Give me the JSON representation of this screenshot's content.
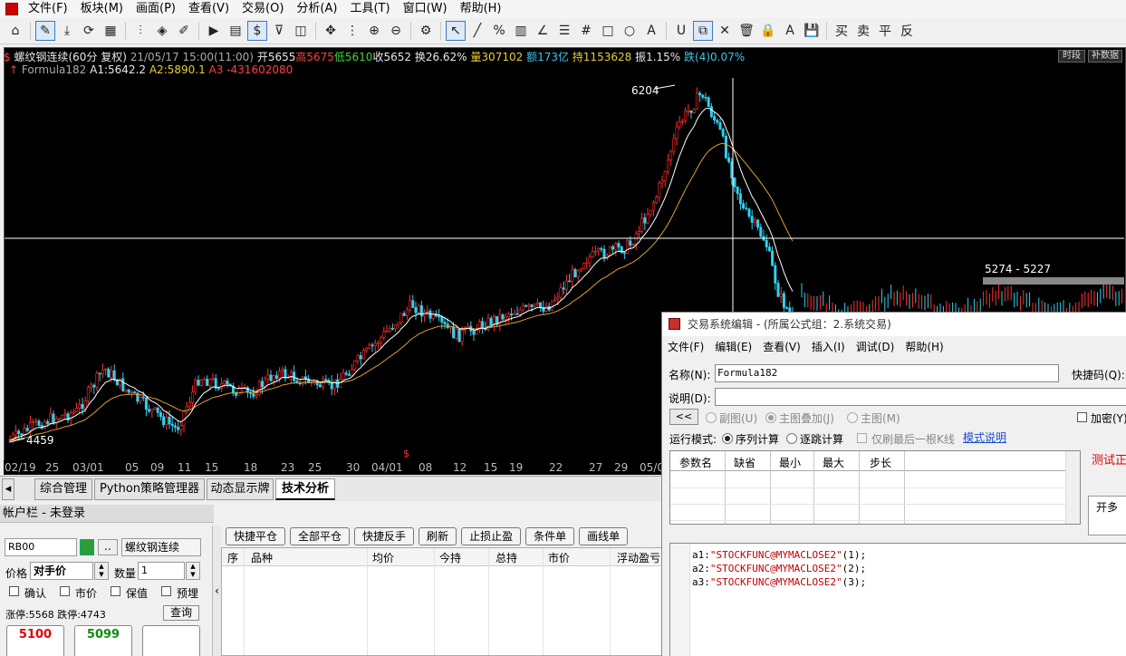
{
  "menu": [
    "文件(F)",
    "板块(M)",
    "画面(P)",
    "查看(V)",
    "交易(O)",
    "分析(A)",
    "工具(T)",
    "窗口(W)",
    "帮助(H)"
  ],
  "chart": {
    "symbol": "螺纹钢连续(60分 复权)",
    "datetime": "21/05/17 15:00(11:00)",
    "open": "开5655",
    "high": "高5675",
    "low": "低5610",
    "close": "收5652",
    "turnover": "换26.62%",
    "volume": "量307102",
    "amount": "额173亿",
    "oi": "持1153628",
    "amp": "振1.15%",
    "chg": "跌(4)0.07%",
    "formula": "Formula182",
    "a1": "A1:5642.2",
    "a2": "A2:5890.1",
    "a3": "A3 -431602080",
    "btn_time": "时段",
    "btn_supp": "补数据",
    "high_label": "6204",
    "low_label": "4459",
    "range_label": "5274 - 5227",
    "dates": [
      "02/19",
      "25",
      "03/01",
      "05",
      "09",
      "11",
      "15",
      "18",
      "23",
      "25",
      "30",
      "04/01",
      "08",
      "12",
      "15",
      "19",
      "22",
      "27",
      "29",
      "05/0"
    ]
  },
  "tabs": [
    "综合管理",
    "Python策略管理器",
    "动态显示牌",
    "技术分析"
  ],
  "account": {
    "title": "帐户栏 - 未登录"
  },
  "order": {
    "code": "RB00",
    "name": "螺纹钢连续",
    "price_label": "价格",
    "price_value": "对手价",
    "qty_label": "数量",
    "qty_value": "1",
    "confirm": "确认",
    "market": "市价",
    "keep": "保值",
    "pre": "预埋",
    "limit": "涨停:5568 跌停:4743",
    "query": "查询",
    "buy_price": "5100",
    "sell_price": "5099"
  },
  "positions": {
    "buttons": [
      "快捷平仓",
      "全部平仓",
      "快捷反手",
      "刷新",
      "止损止盈",
      "条件单",
      "画线单"
    ],
    "columns": [
      "序",
      "品种",
      "均价",
      "今持",
      "总持",
      "市价",
      "浮动盈亏"
    ]
  },
  "dialog": {
    "title": "交易系统编辑 - (所属公式组：2.系统交易)",
    "menu": [
      "文件(F)",
      "编辑(E)",
      "查看(V)",
      "插入(I)",
      "调试(D)",
      "帮助(H)"
    ],
    "name_label": "名称(N):",
    "name_value": "Formula182",
    "hotkey_label": "快捷码(Q):",
    "desc_label": "说明(D):",
    "collapse": "<<",
    "sub": "副图(U)",
    "main_overlay": "主图叠加(J)",
    "main": "主图(M)",
    "encrypt": "加密(Y)",
    "run_mode_label": "运行模式:",
    "seq": "序列计算",
    "tick": "逐跳计算",
    "last_only": "仅刷最后一根K线",
    "mode_help": "模式说明",
    "params_header": [
      "参数名",
      "缺省",
      "最小",
      "最大",
      "步长"
    ],
    "test": "测试正",
    "open_more": "开多",
    "code": [
      {
        "pre": "a1:",
        "str": "\"STOCKFUNC@MYMACLOSE2\"",
        "post": "(1);"
      },
      {
        "pre": "a2:",
        "str": "\"STOCKFUNC@MYMACLOSE2\"",
        "post": "(2);"
      },
      {
        "pre": "a3:",
        "str": "\"STOCKFUNC@MYMACLOSE2\"",
        "post": "(3);"
      }
    ]
  },
  "colors": {
    "up": "#ff3030",
    "down": "#30d0f0",
    "ma1": "#ffffff",
    "ma2": "#e0a030"
  }
}
